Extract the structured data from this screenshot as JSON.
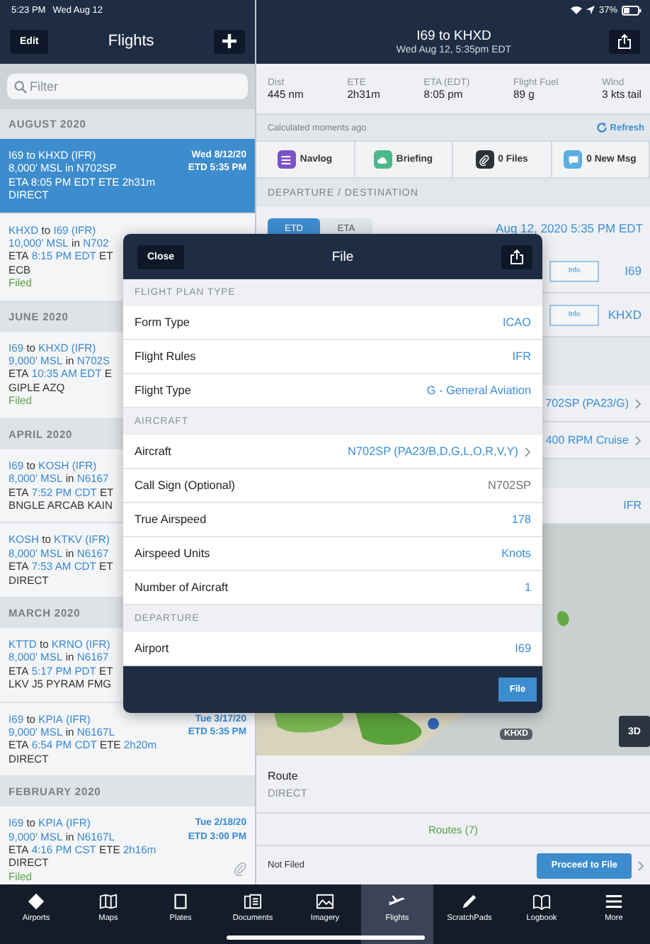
{
  "status_bar": {
    "time": "5:23 PM",
    "date": "Wed Aug 12",
    "battery": "37%"
  },
  "sidebar": {
    "edit_button": "Edit",
    "title": "Flights",
    "filter": {
      "placeholder": "Filter"
    },
    "groups": [
      {
        "month": "AUGUST 2020",
        "flights": [
          {
            "selected": true,
            "lines": [
              [
                {
                  "t": "I69 to KHXD (IFR)",
                  "a": false
                }
              ],
              [
                {
                  "t": "8,000' MSL in N702SP",
                  "a": false
                }
              ],
              [
                {
                  "t": "ETA 8:05 PM EDT ETE 2h31m",
                  "a": false
                }
              ],
              [
                {
                  "t": "DIRECT",
                  "a": false
                }
              ]
            ],
            "date": "Wed 8/12/20",
            "etd": "ETD 5:35 PM",
            "attachment": false
          },
          {
            "selected": false,
            "lines": [
              [
                {
                  "t": "KHXD",
                  "a": true
                },
                {
                  "t": "to",
                  "a": false
                },
                {
                  "t": "I69",
                  "a": true
                },
                {
                  "t": "(IFR)",
                  "a": true
                }
              ],
              [
                {
                  "t": "10,000' MSL",
                  "a": true
                },
                {
                  "t": "in",
                  "a": false
                },
                {
                  "t": "N702",
                  "a": true
                }
              ],
              [
                {
                  "t": "ETA",
                  "a": false
                },
                {
                  "t": "8:15 PM EDT",
                  "a": true
                },
                {
                  "t": "ET",
                  "a": false
                }
              ],
              [
                {
                  "t": "ECB",
                  "a": false
                }
              ]
            ],
            "status": "Filed",
            "attachment": false
          }
        ]
      },
      {
        "month": "JUNE 2020",
        "flights": [
          {
            "selected": false,
            "lines": [
              [
                {
                  "t": "I69",
                  "a": true
                },
                {
                  "t": "to",
                  "a": false
                },
                {
                  "t": "KHXD",
                  "a": true
                },
                {
                  "t": "(IFR)",
                  "a": true
                }
              ],
              [
                {
                  "t": "9,000' MSL",
                  "a": true
                },
                {
                  "t": "in",
                  "a": false
                },
                {
                  "t": "N702S",
                  "a": true
                }
              ],
              [
                {
                  "t": "ETA",
                  "a": false
                },
                {
                  "t": "10:35 AM EDT",
                  "a": true
                },
                {
                  "t": "E",
                  "a": false
                }
              ],
              [
                {
                  "t": "GIPLE AZQ",
                  "a": false
                }
              ]
            ],
            "status": "Filed",
            "attachment": false
          }
        ]
      },
      {
        "month": "APRIL 2020",
        "flights": [
          {
            "selected": false,
            "lines": [
              [
                {
                  "t": "I69",
                  "a": true
                },
                {
                  "t": "to",
                  "a": false
                },
                {
                  "t": "KOSH",
                  "a": true
                },
                {
                  "t": "(IFR)",
                  "a": true
                }
              ],
              [
                {
                  "t": "8,000' MSL",
                  "a": true
                },
                {
                  "t": "in",
                  "a": false
                },
                {
                  "t": "N6167",
                  "a": true
                }
              ],
              [
                {
                  "t": "ETA",
                  "a": false
                },
                {
                  "t": "7:52 PM CDT",
                  "a": true
                },
                {
                  "t": "ET",
                  "a": false
                }
              ],
              [
                {
                  "t": "BNGLE ARCAB KAIN",
                  "a": false
                }
              ]
            ],
            "attachment": false
          },
          {
            "selected": false,
            "lines": [
              [
                {
                  "t": "KOSH",
                  "a": true
                },
                {
                  "t": "to",
                  "a": false
                },
                {
                  "t": "KTKV",
                  "a": true
                },
                {
                  "t": "(IFR)",
                  "a": true
                }
              ],
              [
                {
                  "t": "8,000' MSL",
                  "a": true
                },
                {
                  "t": "in",
                  "a": false
                },
                {
                  "t": "N6167",
                  "a": true
                }
              ],
              [
                {
                  "t": "ETA",
                  "a": false
                },
                {
                  "t": "7:53 AM CDT",
                  "a": true
                },
                {
                  "t": "ET",
                  "a": false
                }
              ],
              [
                {
                  "t": "DIRECT",
                  "a": false
                }
              ]
            ],
            "attachment": false
          }
        ]
      },
      {
        "month": "MARCH 2020",
        "flights": [
          {
            "selected": false,
            "lines": [
              [
                {
                  "t": "KTTD",
                  "a": true
                },
                {
                  "t": "to",
                  "a": false
                },
                {
                  "t": "KRNO",
                  "a": true
                },
                {
                  "t": "(IFR)",
                  "a": true
                }
              ],
              [
                {
                  "t": "8,000' MSL",
                  "a": true
                },
                {
                  "t": "in",
                  "a": false
                },
                {
                  "t": "N6167",
                  "a": true
                }
              ],
              [
                {
                  "t": "ETA",
                  "a": false
                },
                {
                  "t": "5:17 PM PDT",
                  "a": true
                },
                {
                  "t": "ET",
                  "a": false
                }
              ],
              [
                {
                  "t": "LKV J5 PYRAM FMG",
                  "a": false
                }
              ]
            ],
            "attachment": false
          },
          {
            "selected": false,
            "lines": [
              [
                {
                  "t": "I69",
                  "a": true
                },
                {
                  "t": "to",
                  "a": false
                },
                {
                  "t": "KPIA",
                  "a": true
                },
                {
                  "t": "(IFR)",
                  "a": true
                }
              ],
              [
                {
                  "t": "9,000' MSL",
                  "a": true
                },
                {
                  "t": "in",
                  "a": false
                },
                {
                  "t": "N6167L",
                  "a": true
                }
              ],
              [
                {
                  "t": "ETA",
                  "a": false
                },
                {
                  "t": "6:54 PM CDT",
                  "a": true
                },
                {
                  "t": "ETE",
                  "a": false
                },
                {
                  "t": "2h20m",
                  "a": true
                }
              ],
              [
                {
                  "t": "DIRECT",
                  "a": false
                }
              ]
            ],
            "date": "Tue 3/17/20",
            "etd": "ETD 5:35 PM",
            "attachment": false
          }
        ]
      },
      {
        "month": "FEBRUARY 2020",
        "flights": [
          {
            "selected": false,
            "lines": [
              [
                {
                  "t": "I69",
                  "a": true
                },
                {
                  "t": "to",
                  "a": false
                },
                {
                  "t": "KPIA",
                  "a": true
                },
                {
                  "t": "(IFR)",
                  "a": true
                }
              ],
              [
                {
                  "t": "9,000' MSL",
                  "a": true
                },
                {
                  "t": "in",
                  "a": false
                },
                {
                  "t": "N6167L",
                  "a": true
                }
              ],
              [
                {
                  "t": "ETA",
                  "a": false
                },
                {
                  "t": "4:16 PM CST",
                  "a": true
                },
                {
                  "t": "ETE",
                  "a": false
                },
                {
                  "t": "2h16m",
                  "a": true
                }
              ],
              [
                {
                  "t": "DIRECT",
                  "a": false
                }
              ]
            ],
            "status": "Filed",
            "date": "Tue 2/18/20",
            "etd": "ETD 3:00 PM",
            "attachment": true
          }
        ]
      }
    ]
  },
  "flight": {
    "title": "I69 to KHXD",
    "subtitle": "Wed Aug 12, 5:35pm EDT",
    "stats": [
      {
        "label": "Dist",
        "value": "445 nm"
      },
      {
        "label": "ETE",
        "value": "2h31m"
      },
      {
        "label": "ETA (EDT)",
        "value": "8:05 pm"
      },
      {
        "label": "Flight Fuel",
        "value": "89 g"
      },
      {
        "label": "Wind",
        "value": "3 kts tail"
      }
    ],
    "calculated": "Calculated moments ago",
    "refresh": "Refresh",
    "actions": [
      {
        "kind": "navlog",
        "label": "Navlog",
        "color": "#7b52c8"
      },
      {
        "kind": "briefing",
        "label": "Briefing",
        "color": "#4cb98a"
      },
      {
        "kind": "files",
        "label": "0 Files",
        "color": "#2d3238"
      },
      {
        "kind": "messages",
        "label": "0 New Msg",
        "color": "#5aaee0"
      }
    ],
    "section": "DEPARTURE / DESTINATION",
    "time_toggle": [
      {
        "label": "ETD",
        "selected": true
      },
      {
        "label": "ETA",
        "selected": false
      }
    ],
    "datetime": "Aug 12, 2020 5:35 PM EDT",
    "airports": [
      {
        "button": "Info",
        "code": "I69"
      },
      {
        "button": "Info",
        "code": "KHXD"
      }
    ],
    "aircraft_rows": [
      {
        "value": "702SP (PA23/G)"
      },
      {
        "value": "400 RPM Cruise"
      }
    ],
    "rules": "IFR",
    "map": {
      "pin_label": "KHXD",
      "view_button": "3D"
    },
    "route": {
      "label": "Route",
      "value": "DIRECT"
    },
    "routes_link": "Routes (7)",
    "filing": {
      "status": "Not Filed",
      "button": "Proceed to File"
    }
  },
  "modal": {
    "close": "Close",
    "title": "File",
    "footer_button": "File",
    "sections": [
      {
        "title": "FLIGHT PLAN TYPE",
        "rows": [
          {
            "label": "Form Type",
            "value": "ICAO",
            "muted": false,
            "chevron": false
          },
          {
            "label": "Flight Rules",
            "value": "IFR",
            "muted": false,
            "chevron": false
          },
          {
            "label": "Flight Type",
            "value": "G - General Aviation",
            "muted": false,
            "chevron": false
          }
        ]
      },
      {
        "title": "AIRCRAFT",
        "rows": [
          {
            "label": "Aircraft",
            "value": "N702SP (PA23/B,D,G,L,O,R,V,Y)",
            "muted": false,
            "chevron": true
          },
          {
            "label": "Call Sign (Optional)",
            "value": "N702SP",
            "muted": true,
            "chevron": false
          },
          {
            "label": "True Airspeed",
            "value": "178",
            "muted": false,
            "chevron": false
          },
          {
            "label": "Airspeed Units",
            "value": "Knots",
            "muted": false,
            "chevron": false
          },
          {
            "label": "Number of Aircraft",
            "value": "1",
            "muted": false,
            "chevron": false
          }
        ]
      },
      {
        "title": "DEPARTURE",
        "rows": [
          {
            "label": "Airport",
            "value": "I69",
            "muted": false,
            "chevron": false
          }
        ]
      }
    ]
  },
  "tabs": [
    {
      "kind": "airports",
      "label": "Airports",
      "selected": false
    },
    {
      "kind": "maps",
      "label": "Maps",
      "selected": false
    },
    {
      "kind": "plates",
      "label": "Plates",
      "selected": false
    },
    {
      "kind": "documents",
      "label": "Documents",
      "selected": false
    },
    {
      "kind": "imagery",
      "label": "Imagery",
      "selected": false
    },
    {
      "kind": "flights",
      "label": "Flights",
      "selected": true
    },
    {
      "kind": "scratchpads",
      "label": "ScratchPads",
      "selected": false
    },
    {
      "kind": "logbook",
      "label": "Logbook",
      "selected": false
    },
    {
      "kind": "more",
      "label": "More",
      "selected": false
    }
  ]
}
